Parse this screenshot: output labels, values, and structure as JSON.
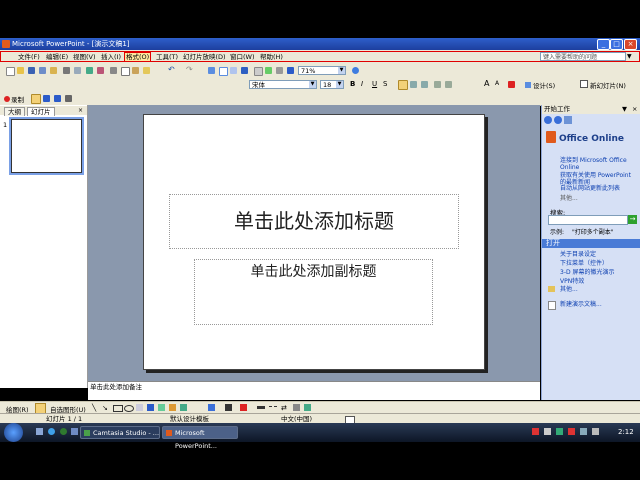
{
  "window": {
    "title": "Microsoft PowerPoint - [演示文稿1]"
  },
  "menu": {
    "items": [
      "文件(F)",
      "编辑(E)",
      "视图(V)",
      "插入(I)",
      "格式(O)",
      "工具(T)",
      "幻灯片放映(D)",
      "窗口(W)",
      "帮助(H)"
    ],
    "active_index": 4,
    "ask_placeholder": "键入需要帮助的问题"
  },
  "toolbar": {
    "zoom": "71%",
    "font": "宋体",
    "font_size": "18",
    "design_label": "设计(S)",
    "new_slide_label": "新幻灯片(N)"
  },
  "toolbar3": {
    "record_label": "录制"
  },
  "outline": {
    "tab_outline": "大纲",
    "tab_slides": "幻灯片",
    "slide_number": "1"
  },
  "slide": {
    "title_placeholder": "单击此处添加标题",
    "subtitle_placeholder": "单击此处添加副标题"
  },
  "notes": {
    "placeholder": "单击此处添加备注"
  },
  "taskpane": {
    "title": "开始工作",
    "brand": "Office Online",
    "links": [
      "连接到 Microsoft Office Online",
      "获取有关使用 PowerPoint 的最新新闻",
      "自动从网站更新此列表"
    ],
    "more": "其他...",
    "search_label": "搜索:",
    "example_label": "示例:",
    "example_text": "\"打印多个副本\"",
    "open_section": "打开",
    "recent": [
      "关于目录设定",
      "下拉菜单（控件）",
      "3-D 屏幕的徽光演示",
      "VPN特效"
    ],
    "more2": "其他...",
    "new_presentation": "新建演示文稿..."
  },
  "drawbar": {
    "draw_label": "绘图(R)",
    "autoshapes_label": "自选图形(U)"
  },
  "status": {
    "slide": "幻灯片 1 / 1",
    "template": "默认设计模板",
    "language": "中文(中国)"
  },
  "taskbar": {
    "tasks": [
      "Camtasia Studio - ...",
      "Microsoft PowerPoint..."
    ],
    "time": "2:12"
  },
  "colors": {
    "accent": "#e00000",
    "workspace": "#8a98ad",
    "titlebar": "#2e5fcb",
    "taskpane": "#d6e0f5"
  }
}
